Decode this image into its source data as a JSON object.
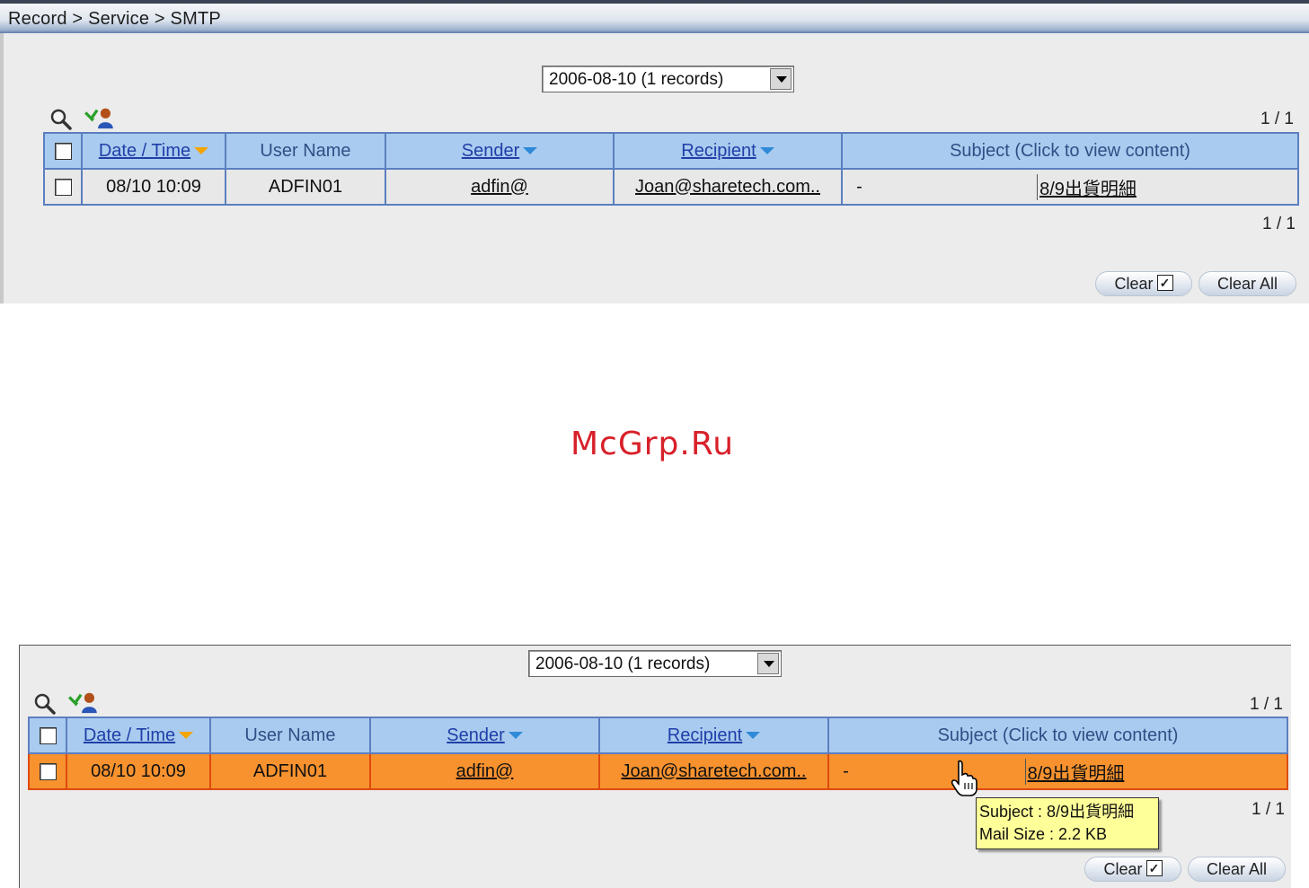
{
  "breadcrumb": "Record > Service > SMTP",
  "watermark": "McGrp.Ru",
  "top": {
    "date_select": "2006-08-10 (1 records)",
    "pager_top": "1 / 1",
    "pager_bottom": "1 / 1",
    "columns": {
      "datetime": "Date / Time",
      "username": "User Name",
      "sender": "Sender",
      "recipient": "Recipient",
      "subject": "Subject (Click to view content)"
    },
    "row": {
      "datetime": "08/10 10:09",
      "username": "ADFIN01",
      "sender": "adfin@",
      "recipient": "Joan@sharetech.com..",
      "flag": "-",
      "subject": "8/9出貨明細"
    },
    "clear_label": "Clear",
    "clear_all_label": "Clear All"
  },
  "bottom": {
    "date_select": "2006-08-10 (1 records)",
    "pager_top": "1 / 1",
    "pager_bottom": "1 / 1",
    "columns": {
      "datetime": "Date / Time",
      "username": "User Name",
      "sender": "Sender",
      "recipient": "Recipient",
      "subject": "Subject (Click to view content)"
    },
    "row": {
      "datetime": "08/10 10:09",
      "username": "ADFIN01",
      "sender": "adfin@",
      "recipient": "Joan@sharetech.com..",
      "flag": "-",
      "subject": "8/9出貨明細"
    },
    "tooltip": {
      "subject_line": "Subject : 8/9出貨明細",
      "size_line": "Mail Size : 2.2 KB"
    },
    "clear_label": "Clear",
    "clear_all_label": "Clear All"
  },
  "colors": {
    "header_bg": "#a9cbef",
    "grid_border": "#5b7fc0",
    "highlight_row": "#f7922f",
    "tooltip_bg": "#ffff99",
    "watermark": "#d8202a"
  },
  "icons": [
    "search-icon",
    "user-export-icon",
    "dropdown-arrow-icon",
    "sort-down-icon",
    "hand-cursor-icon"
  ]
}
